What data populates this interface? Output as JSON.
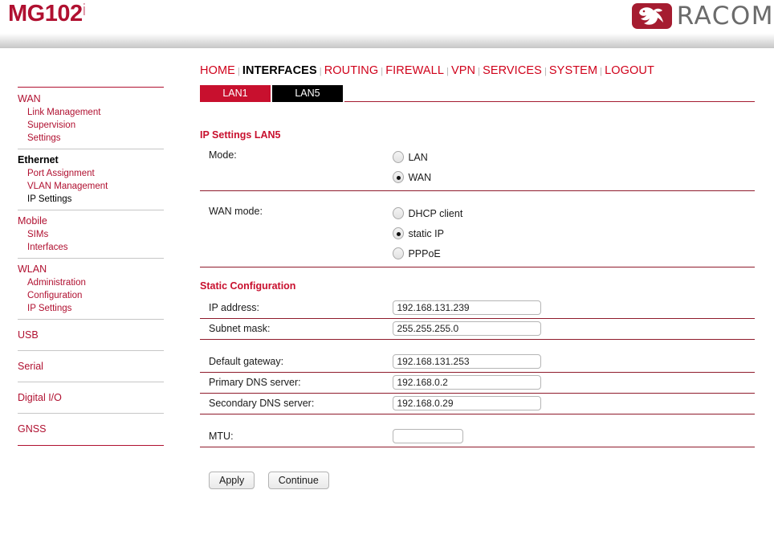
{
  "header": {
    "product_title": "MG102",
    "product_title_suffix": "i",
    "brand": "RACOM",
    "logo_icon": "racom-bird-logo"
  },
  "topnav": {
    "items": [
      {
        "label": "HOME",
        "active": false
      },
      {
        "label": "INTERFACES",
        "active": true
      },
      {
        "label": "ROUTING",
        "active": false
      },
      {
        "label": "FIREWALL",
        "active": false
      },
      {
        "label": "VPN",
        "active": false
      },
      {
        "label": "SERVICES",
        "active": false
      },
      {
        "label": "SYSTEM",
        "active": false
      },
      {
        "label": "LOGOUT",
        "active": false
      }
    ],
    "separator": "|"
  },
  "tabs": [
    {
      "label": "LAN1",
      "active": false
    },
    {
      "label": "LAN5",
      "active": true
    }
  ],
  "sidebar": {
    "groups": [
      {
        "title": "WAN",
        "active": false,
        "items": [
          {
            "label": "Link Management",
            "active": false
          },
          {
            "label": "Supervision",
            "active": false
          },
          {
            "label": "Settings",
            "active": false
          }
        ]
      },
      {
        "title": "Ethernet",
        "active": true,
        "items": [
          {
            "label": "Port Assignment",
            "active": false
          },
          {
            "label": "VLAN Management",
            "active": false
          },
          {
            "label": "IP Settings",
            "active": true
          }
        ]
      },
      {
        "title": "Mobile",
        "active": false,
        "items": [
          {
            "label": "SIMs",
            "active": false
          },
          {
            "label": "Interfaces",
            "active": false
          }
        ]
      },
      {
        "title": "WLAN",
        "active": false,
        "items": [
          {
            "label": "Administration",
            "active": false
          },
          {
            "label": "Configuration",
            "active": false
          },
          {
            "label": "IP Settings",
            "active": false
          }
        ]
      }
    ],
    "standalone": [
      {
        "label": "USB"
      },
      {
        "label": "Serial"
      },
      {
        "label": "Digital I/O"
      },
      {
        "label": "GNSS"
      }
    ]
  },
  "main": {
    "section_ip_settings": "IP Settings LAN5",
    "section_static_config": "Static Configuration",
    "mode": {
      "label": "Mode:",
      "options": [
        {
          "label": "LAN",
          "checked": false
        },
        {
          "label": "WAN",
          "checked": true
        }
      ]
    },
    "wan_mode": {
      "label": "WAN mode:",
      "options": [
        {
          "label": "DHCP client",
          "checked": false
        },
        {
          "label": "static IP",
          "checked": true
        },
        {
          "label": "PPPoE",
          "checked": false
        }
      ]
    },
    "fields": {
      "ip_address": {
        "label": "IP address:",
        "value": "192.168.131.239"
      },
      "subnet_mask": {
        "label": "Subnet mask:",
        "value": "255.255.255.0"
      },
      "default_gateway": {
        "label": "Default gateway:",
        "value": "192.168.131.253"
      },
      "primary_dns": {
        "label": "Primary DNS server:",
        "value": "192.168.0.2"
      },
      "secondary_dns": {
        "label": "Secondary DNS server:",
        "value": "192.168.0.29"
      },
      "mtu": {
        "label": "MTU:",
        "value": ""
      }
    },
    "buttons": {
      "apply": "Apply",
      "continue": "Continue"
    }
  },
  "colors": {
    "brand_red": "#b01030",
    "nav_red": "#d0021b",
    "tab_red": "#c8102e",
    "rule_red": "#8f1b2c",
    "logo_gray": "#6b6b6b"
  }
}
